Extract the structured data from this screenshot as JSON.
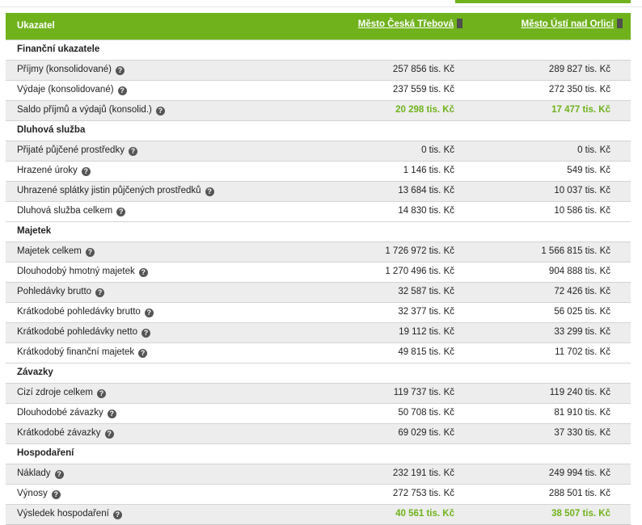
{
  "header": {
    "col_label": "Ukazatel",
    "city_a": "Město Česká Třebová",
    "city_b": "Město Ústí nad Orlicí"
  },
  "colors": {
    "accent": "#6fb21c",
    "help_icon": "#555555",
    "row_alt": "#ededed"
  },
  "icons": {
    "help": "question-circle-icon",
    "delete": "trash-icon"
  },
  "rows": [
    {
      "type": "section",
      "label": "Finanční ukazatele"
    },
    {
      "type": "data",
      "label": "Příjmy (konsolidované)",
      "a": "257 856 tis. Kč",
      "b": "289 827 tis. Kč"
    },
    {
      "type": "data",
      "label": "Výdaje (konsolidované)",
      "a": "237 559 tis. Kč",
      "b": "272 350 tis. Kč"
    },
    {
      "type": "data",
      "label": "Saldo příjmů a výdajů (konsolid.)",
      "a": "20 298 tis. Kč",
      "b": "17 477 tis. Kč",
      "highlight": true
    },
    {
      "type": "section",
      "label": "Dluhová služba"
    },
    {
      "type": "data",
      "label": "Přijaté půjčené prostředky",
      "a": "0 tis. Kč",
      "b": "0 tis. Kč"
    },
    {
      "type": "data",
      "label": "Hrazené úroky",
      "a": "1 146 tis. Kč",
      "b": "549 tis. Kč"
    },
    {
      "type": "data",
      "label": "Uhrazené splátky jistin půjčených prostředků",
      "a": "13 684 tis. Kč",
      "b": "10 037 tis. Kč"
    },
    {
      "type": "data",
      "label": "Dluhová služba celkem",
      "a": "14 830 tis. Kč",
      "b": "10 586 tis. Kč"
    },
    {
      "type": "section",
      "label": "Majetek"
    },
    {
      "type": "data",
      "label": "Majetek celkem",
      "a": "1 726 972 tis. Kč",
      "b": "1 566 815 tis. Kč"
    },
    {
      "type": "data",
      "label": "Dlouhodobý hmotný majetek",
      "a": "1 270 496 tis. Kč",
      "b": "904 888 tis. Kč"
    },
    {
      "type": "data",
      "label": "Pohledávky brutto",
      "a": "32 587 tis. Kč",
      "b": "72 426 tis. Kč"
    },
    {
      "type": "data",
      "label": "Krátkodobé pohledávky brutto",
      "a": "32 377 tis. Kč",
      "b": "56 025 tis. Kč"
    },
    {
      "type": "data",
      "label": "Krátkodobé pohledávky netto",
      "a": "19 112 tis. Kč",
      "b": "33 299 tis. Kč"
    },
    {
      "type": "data",
      "label": "Krátkodobý finanční majetek",
      "a": "49 815 tis. Kč",
      "b": "11 702 tis. Kč"
    },
    {
      "type": "section",
      "label": "Závazky"
    },
    {
      "type": "data",
      "label": "Cizí zdroje celkem",
      "a": "119 737 tis. Kč",
      "b": "119 240 tis. Kč"
    },
    {
      "type": "data",
      "label": "Dlouhodobé závazky",
      "a": "50 708 tis. Kč",
      "b": "81 910 tis. Kč"
    },
    {
      "type": "data",
      "label": "Krátkodobé závazky",
      "a": "69 029 tis. Kč",
      "b": "37 330 tis. Kč"
    },
    {
      "type": "section",
      "label": "Hospodaření"
    },
    {
      "type": "data",
      "label": "Náklady",
      "a": "232 191 tis. Kč",
      "b": "249 994 tis. Kč"
    },
    {
      "type": "data",
      "label": "Výnosy",
      "a": "272 753 tis. Kč",
      "b": "288 501 tis. Kč"
    },
    {
      "type": "data",
      "label": "Výsledek hospodaření",
      "a": "40 561 tis. Kč",
      "b": "38 507 tis. Kč",
      "highlight": true
    }
  ]
}
